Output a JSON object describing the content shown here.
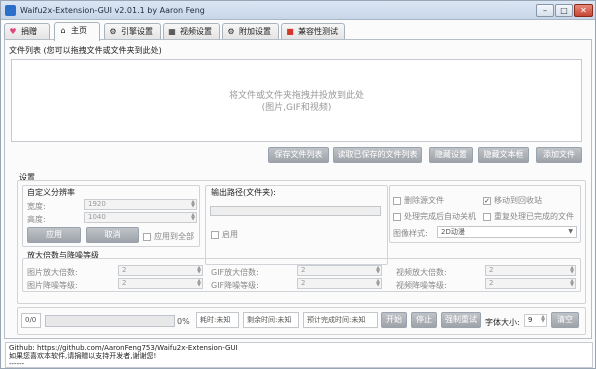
{
  "window": {
    "title": "Waifu2x-Extension-GUI v2.01.1 by Aaron Feng",
    "minimize": "–",
    "restore": "□",
    "close": "✕"
  },
  "tabs": [
    {
      "label": "捐赠",
      "icon": "heart-icon"
    },
    {
      "label": "主页",
      "icon": "home-icon"
    },
    {
      "label": "引擎设置",
      "icon": "gear-icon"
    },
    {
      "label": "视频设置",
      "icon": "film-icon"
    },
    {
      "label": "附加设置",
      "icon": "sliders-icon"
    },
    {
      "label": "兼容性测试",
      "icon": "test-icon"
    }
  ],
  "file_list": {
    "label": "文件列表 (您可以拖拽文件或文件夹到此处)",
    "drop_hint_1": "将文件或文件夹拖拽并投放到此处",
    "drop_hint_2": "(图片,GIF和视频)",
    "buttons": {
      "save": "保存文件列表",
      "read": "读取已保存的文件列表",
      "hide_settings": "隐藏设置",
      "hide_textbox": "隐藏文本框",
      "add": "添加文件"
    }
  },
  "settings": {
    "label": "设置",
    "custom_res": {
      "label": "自定义分辨率",
      "width_label": "宽度:",
      "width": "1920",
      "height_label": "高度:",
      "height": "1040",
      "apply": "应用",
      "cancel": "取消",
      "apply_all": "应用到全部"
    },
    "output": {
      "label": "输出路径(文件夹):",
      "enable": "启用"
    },
    "options": {
      "delete_source": "删除源文件",
      "move_to_recycle": "移动到回收站",
      "shutdown": "处理完成后自动关机",
      "reprocess": "重复处理已完成的文件",
      "image_style_label": "图像样式:",
      "image_style": "2D动漫"
    },
    "scale": {
      "label": "放大倍数与降噪等级",
      "image_scale_label": "图片放大倍数:",
      "image_scale": "2",
      "image_denoise_label": "图片降噪等级:",
      "image_denoise": "2",
      "gif_scale_label": "GIF放大倍数:",
      "gif_scale": "2",
      "gif_denoise_label": "GIF降噪等级:",
      "gif_denoise": "2",
      "video_scale_label": "视频放大倍数:",
      "video_scale": "2",
      "video_denoise_label": "视频降噪等级:",
      "video_denoise": "2"
    }
  },
  "bottom": {
    "count": "0/0",
    "progress": 0,
    "percent": "0%",
    "elapsed": "耗时:未知",
    "remaining": "剩余时间:未知",
    "eta": "预计完成时间:未知",
    "start": "开始",
    "stop": "停止",
    "force_retry": "强制重试",
    "font_size_label": "字体大小:",
    "font_size": "9",
    "clear": "清空"
  },
  "log": {
    "line1": "Github: https://github.com/AaronFeng753/Waifu2x-Extension-GUI",
    "line2": "如果您喜欢本软件,请捐赠以支持开发者,谢谢您!",
    "line3": "------"
  }
}
